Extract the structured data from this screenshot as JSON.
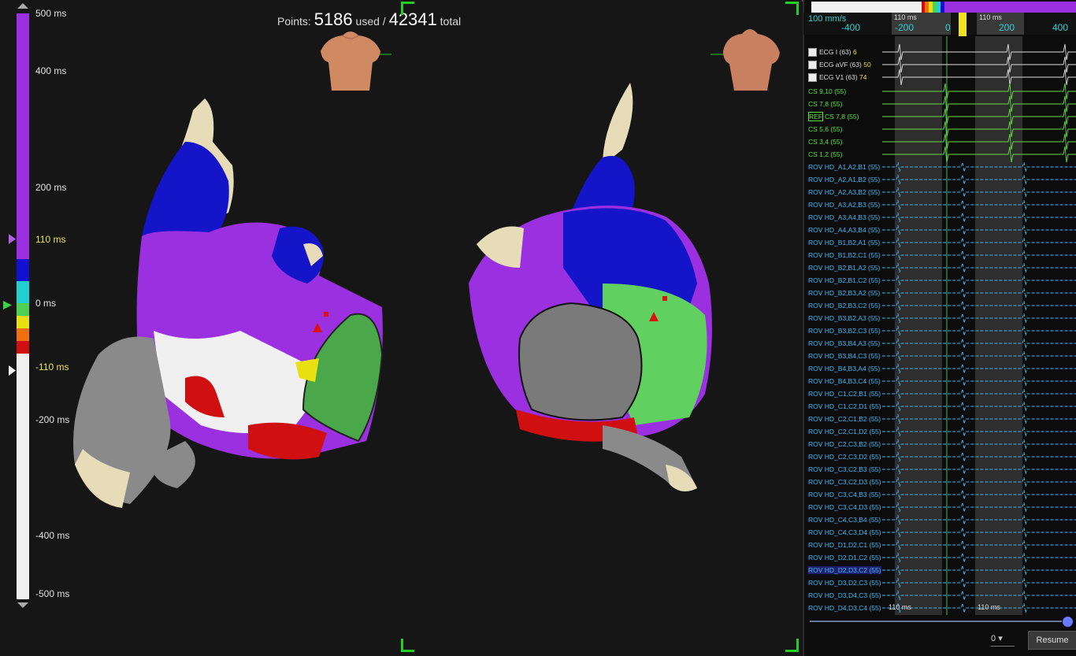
{
  "colorbar": {
    "labels": [
      "500 ms",
      "400 ms",
      "200 ms",
      "110 ms",
      "0 ms",
      "-110 ms",
      "-200 ms",
      "-400 ms",
      "-500 ms"
    ],
    "segments": [
      {
        "color": "#9b30e0",
        "from": 500,
        "to": 20
      },
      {
        "color": "#1010d0",
        "from": 20,
        "to": 10
      },
      {
        "color": "#20d0d0",
        "from": 10,
        "to": 0
      },
      {
        "color": "#50d050",
        "from": 0,
        "to": -10
      },
      {
        "color": "#e8e010",
        "from": -10,
        "to": -20
      },
      {
        "color": "#f07010",
        "from": -20,
        "to": -30
      },
      {
        "color": "#d01010",
        "from": -30,
        "to": -40
      },
      {
        "color": "#f0f0f0",
        "from": -40,
        "to": -500
      }
    ]
  },
  "points": {
    "prefix": "Points:",
    "used": "5186",
    "used_label": "used /",
    "total": "42341",
    "total_label": "total"
  },
  "ecg_panel": {
    "speed": "100 mm/s",
    "scale_labels": [
      "-400",
      "-200",
      "0",
      "200",
      "400"
    ],
    "window_labels": {
      "left": "110 ms",
      "right": "110 ms",
      "bottom_left": "110 ms",
      "bottom_right": "110 ms"
    },
    "surface": [
      {
        "name": "ECG I (63)",
        "value": "6"
      },
      {
        "name": "ECG aVF (63)",
        "value": "50"
      },
      {
        "name": "ECG V1 (63)",
        "value": "74"
      }
    ],
    "ref_tag": "REF",
    "cs": [
      "CS 9,10 (55)",
      "CS 7,8 (55)",
      "CS 7,8 (55)",
      "CS 5,6 (55)",
      "CS 3,4 (55)",
      "CS 1,2 (55)"
    ],
    "rov": [
      "ROV HD_A1,A2,B1 (55)",
      "ROV HD_A2,A1,B2 (55)",
      "ROV HD_A2,A3,B2 (55)",
      "ROV HD_A3,A2,B3 (55)",
      "ROV HD_A3,A4,B3 (55)",
      "ROV HD_A4,A3,B4 (55)",
      "ROV HD_B1,B2,A1 (55)",
      "ROV HD_B1,B2,C1 (55)",
      "ROV HD_B2,B1,A2 (55)",
      "ROV HD_B2,B1,C2 (55)",
      "ROV HD_B2,B3,A2 (55)",
      "ROV HD_B2,B3,C2 (55)",
      "ROV HD_B3,B2,A3 (55)",
      "ROV HD_B3,B2,C3 (55)",
      "ROV HD_B3,B4,A3 (55)",
      "ROV HD_B3,B4,C3 (55)",
      "ROV HD_B4,B3,A4 (55)",
      "ROV HD_B4,B3,C4 (55)",
      "ROV HD_C1,C2,B1 (55)",
      "ROV HD_C1,C2,D1 (55)",
      "ROV HD_C2,C1,B2 (55)",
      "ROV HD_C2,C1,D2 (55)",
      "ROV HD_C2,C3,B2 (55)",
      "ROV HD_C2,C3,D2 (55)",
      "ROV HD_C3,C2,B3 (55)",
      "ROV HD_C3,C2,D3 (55)",
      "ROV HD_C3,C4,B3 (55)",
      "ROV HD_C3,C4,D3 (55)",
      "ROV HD_C4,C3,B4 (55)",
      "ROV HD_C4,C3,D4 (55)",
      "ROV HD_D1,D2,C1 (55)",
      "ROV HD_D2,D1,C2 (55)",
      "ROV HD_D2,D3,C2 (55)",
      "ROV HD_D3,D2,C3 (55)",
      "ROV HD_D3,D4,C3 (55)",
      "ROV HD_D4,D3,C4 (55)"
    ],
    "zoom_value": "0",
    "resume_label": "Resume"
  },
  "colors": {
    "purple": "#9b30e0",
    "blue": "#1010d0",
    "cyan": "#20d0d0",
    "green": "#50d050",
    "yellow": "#e8e010",
    "red": "#d01010",
    "ecg_green": "#60e040",
    "ecg_cyan": "#40b8f0",
    "accent": "#22d022"
  }
}
